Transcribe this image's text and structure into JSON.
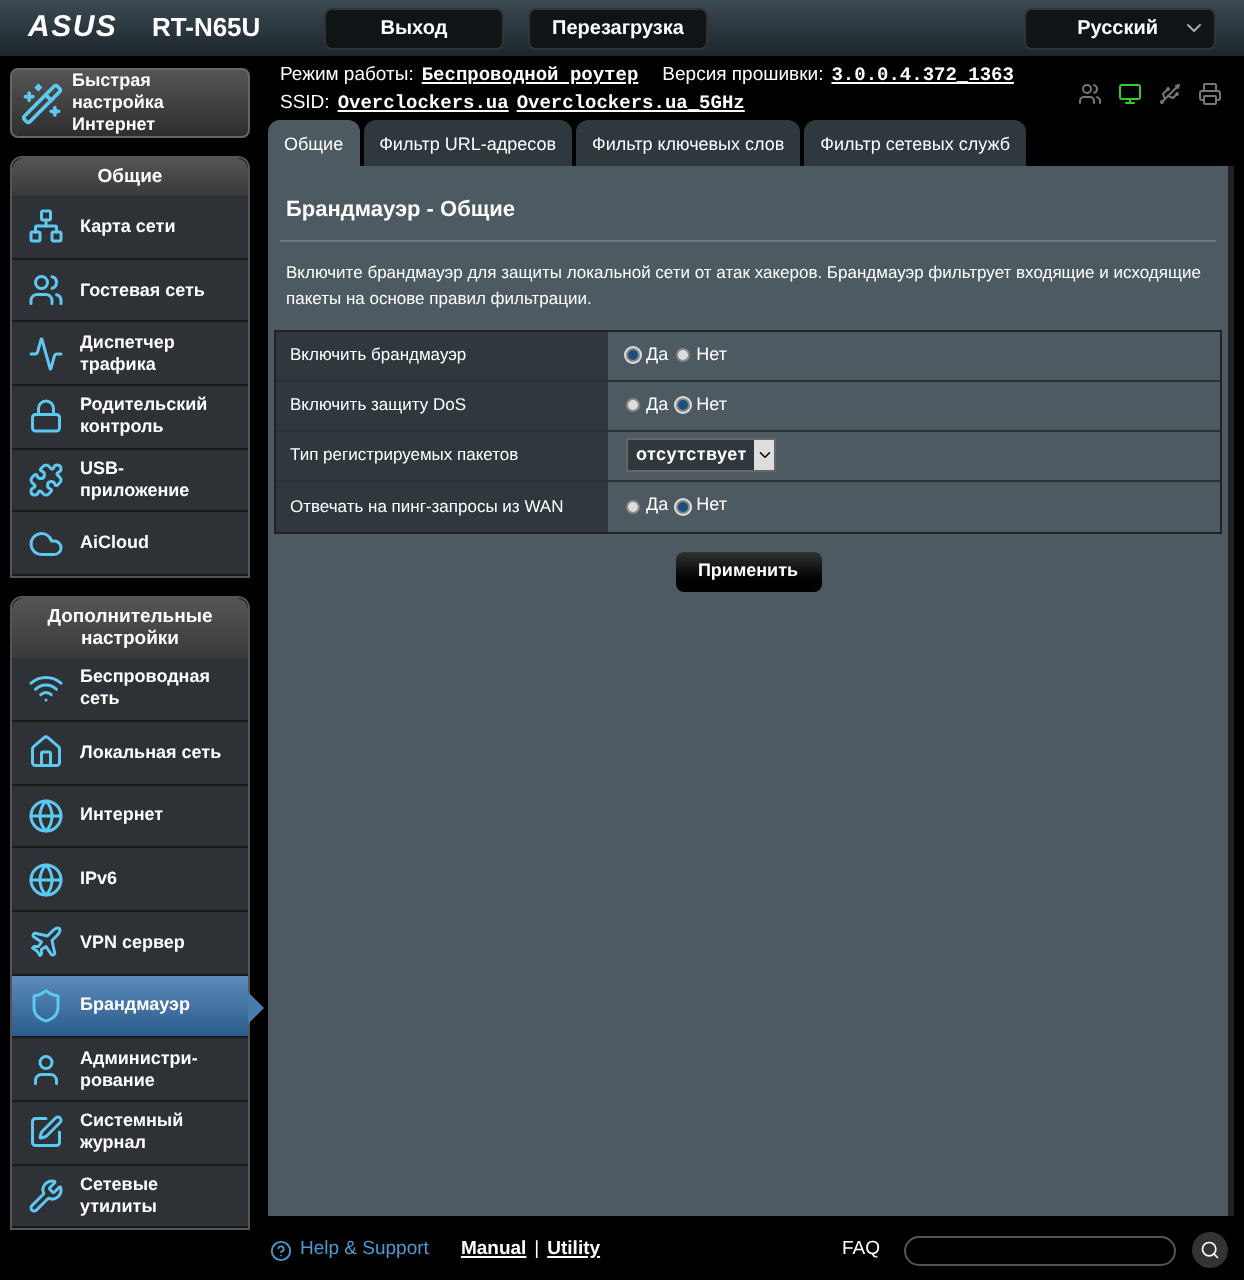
{
  "header": {
    "logo": "ASUS",
    "model": "RT-N65U",
    "buttons": [
      "Выход",
      "Перезагрузка"
    ],
    "language": "Русский"
  },
  "status": {
    "mode_label": "Режим работы:",
    "mode": "Беспроводной роутер",
    "fw_label": "Версия прошивки:",
    "fw": "3.0.0.4.372_1363",
    "ssid_label": "SSID:",
    "ssids": [
      "Overclockers.ua",
      "Overclockers.ua_5GHz"
    ]
  },
  "quick_setup": "Быстрая настройка Интернет",
  "sidebar": [
    {
      "title": "Общие",
      "items": [
        {
          "label": "Карта сети",
          "selected": false
        },
        {
          "label": "Гостевая сеть",
          "selected": false
        },
        {
          "label": "Диспетчер трафика",
          "selected": false
        },
        {
          "label": "Родительский контроль",
          "selected": false
        },
        {
          "label": "USB-приложение",
          "selected": false
        },
        {
          "label": "AiCloud",
          "selected": false
        }
      ]
    },
    {
      "title": "Дополнительные настройки",
      "items": [
        {
          "label": "Беспроводная сеть",
          "selected": false
        },
        {
          "label": "Локальная сеть",
          "selected": false
        },
        {
          "label": "Интернет",
          "selected": false
        },
        {
          "label": "IPv6",
          "selected": false
        },
        {
          "label": "VPN сервер",
          "selected": false
        },
        {
          "label": "Брандмауэр",
          "selected": true
        },
        {
          "label": "Администри-рование",
          "selected": false
        },
        {
          "label": "Системный журнал",
          "selected": false
        },
        {
          "label": "Сетевые утилиты",
          "selected": false
        }
      ]
    }
  ],
  "tabs": [
    {
      "label": "Общие",
      "selected": true
    },
    {
      "label": "Фильтр URL-адресов",
      "selected": false
    },
    {
      "label": "Фильтр ключевых слов",
      "selected": false
    },
    {
      "label": "Фильтр сетевых служб",
      "selected": false
    }
  ],
  "panel": {
    "title": "Брандмауэр - Общие",
    "description": "Включите брандмауэр для защиты локальной сети от атак хакеров. Брандмауэр фильтрует входящие и исходящие пакеты на основе правил фильтрации.",
    "settings": [
      {
        "kind": "radio",
        "label": "Включить брандмауэр",
        "options": [
          {
            "label": "Да",
            "selected": true
          },
          {
            "label": "Нет",
            "selected": false
          }
        ]
      },
      {
        "kind": "radio",
        "label": "Включить защиту DoS",
        "options": [
          {
            "label": "Да",
            "selected": false
          },
          {
            "label": "Нет",
            "selected": true
          }
        ]
      },
      {
        "kind": "select",
        "label": "Тип регистрируемых пакетов",
        "value": "отсутствует"
      },
      {
        "kind": "radio",
        "label": "Отвечать на пинг-запросы из WAN",
        "options": [
          {
            "label": "Да",
            "selected": false
          },
          {
            "label": "Нет",
            "selected": true
          }
        ]
      }
    ],
    "apply": "Применить"
  },
  "footer": {
    "help": "Help & Support",
    "manual": "Manual",
    "separator": "|",
    "utility": "Utility",
    "faq": "FAQ"
  }
}
